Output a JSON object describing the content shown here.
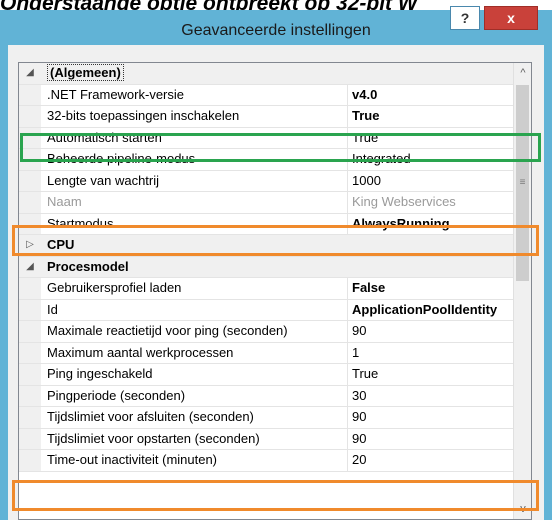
{
  "caption": "Onderstaande optie ontbreekt op 32-bit W",
  "window": {
    "title": "Geavanceerde instellingen",
    "help_label": "?",
    "close_label": "x"
  },
  "grid": {
    "rows": [
      {
        "kind": "category",
        "toggle": "◢",
        "name": "(Algemeen)",
        "value": ""
      },
      {
        "kind": "property",
        "name": ".NET Framework-versie",
        "value": "v4.0",
        "value_bold": true
      },
      {
        "kind": "property",
        "name": "32-bits toepassingen inschakelen",
        "value": "True",
        "value_bold": true
      },
      {
        "kind": "property",
        "name": "Automatisch starten",
        "value": "True"
      },
      {
        "kind": "property",
        "name": "Beheerde pipeline-modus",
        "value": "Integrated"
      },
      {
        "kind": "property",
        "name": "Lengte van wachtrij",
        "value": "1000"
      },
      {
        "kind": "property",
        "name": "Naam",
        "value": "King Webservices",
        "disabled": true
      },
      {
        "kind": "property",
        "name": "Startmodus",
        "value": "AlwaysRunning",
        "value_bold": true
      },
      {
        "kind": "category",
        "toggle": "▷",
        "name": "CPU",
        "value": ""
      },
      {
        "kind": "category",
        "toggle": "◢",
        "name": "Procesmodel",
        "value": ""
      },
      {
        "kind": "property",
        "name": "Gebruikersprofiel laden",
        "value": "False",
        "value_bold": true
      },
      {
        "kind": "property",
        "name": "Id",
        "value": "ApplicationPoolIdentity",
        "value_bold": true
      },
      {
        "kind": "property",
        "name": "Maximale reactietijd voor ping (seconden)",
        "value": "90"
      },
      {
        "kind": "property",
        "name": "Maximum aantal werkprocessen",
        "value": "1"
      },
      {
        "kind": "property",
        "name": "Ping ingeschakeld",
        "value": "True"
      },
      {
        "kind": "property",
        "name": "Pingperiode (seconden)",
        "value": "30"
      },
      {
        "kind": "property",
        "name": "Tijdslimiet voor afsluiten (seconden)",
        "value": "90"
      },
      {
        "kind": "property",
        "name": "Tijdslimiet voor opstarten (seconden)",
        "value": "90"
      },
      {
        "kind": "property",
        "name": "Time-out inactiviteit (minuten)",
        "value": "20"
      }
    ],
    "scroll_up": "^",
    "scroll_down": "v",
    "thumb_grip": "≡"
  },
  "colors": {
    "highlight_green": "#2aa44f",
    "highlight_orange": "#f08a2c",
    "title_bar": "#61b3d6",
    "close_button": "#c9413a"
  }
}
